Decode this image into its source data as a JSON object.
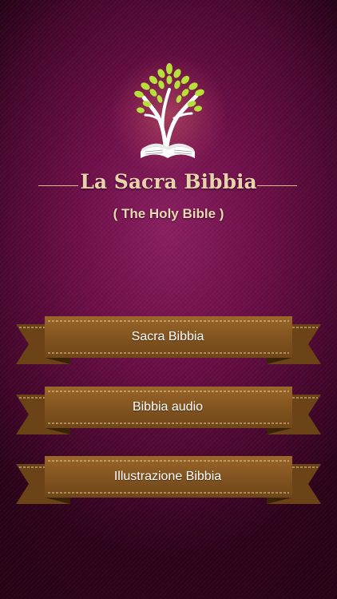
{
  "app": {
    "title": "La Sacra Bibbia",
    "subtitle": "( The Holy Bible )"
  },
  "menu": {
    "items": [
      {
        "label": "Sacra Bibbia"
      },
      {
        "label": "Bibbia audio"
      },
      {
        "label": "Illustrazione Bibbia"
      }
    ]
  },
  "colors": {
    "background": "#6d0f48",
    "title_text": "#e9d3ad",
    "ribbon_face": "#8a5a22",
    "ribbon_tail": "#6b4317",
    "leaf_green": "#b8e03a"
  },
  "icons": {
    "logo": "tree-book-logo-icon"
  }
}
